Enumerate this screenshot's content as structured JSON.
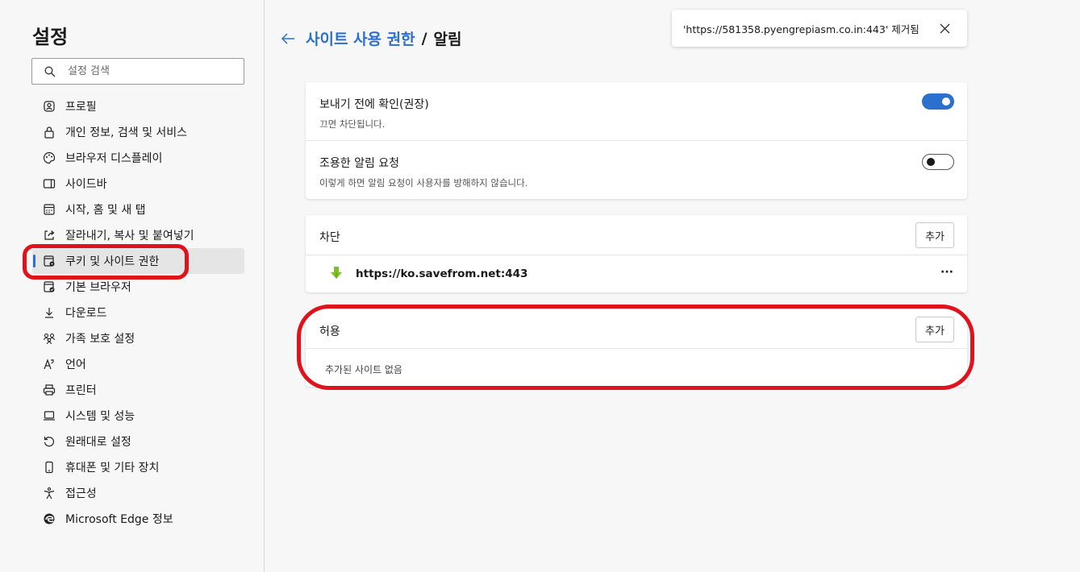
{
  "sidebar": {
    "title": "설정",
    "search_placeholder": "설정 검색",
    "items": [
      {
        "label": "프로필",
        "icon": "profile-icon"
      },
      {
        "label": "개인 정보, 검색 및 서비스",
        "icon": "lock-icon"
      },
      {
        "label": "브라우저 디스플레이",
        "icon": "palette-icon"
      },
      {
        "label": "사이드바",
        "icon": "sidebar-icon"
      },
      {
        "label": "시작, 홈 및 새 탭",
        "icon": "home-tab-icon"
      },
      {
        "label": "잘라내기, 복사 및 붙여넣기",
        "icon": "share-icon"
      },
      {
        "label": "쿠키 및 사이트 권한",
        "icon": "cookie-icon",
        "active": true
      },
      {
        "label": "기본 브라우저",
        "icon": "default-browser-icon"
      },
      {
        "label": "다운로드",
        "icon": "download-icon"
      },
      {
        "label": "가족 보호 설정",
        "icon": "family-icon"
      },
      {
        "label": "언어",
        "icon": "language-icon"
      },
      {
        "label": "프린터",
        "icon": "printer-icon"
      },
      {
        "label": "시스템 및 성능",
        "icon": "laptop-icon"
      },
      {
        "label": "원래대로 설정",
        "icon": "reset-icon"
      },
      {
        "label": "휴대폰 및 기타 장치",
        "icon": "phone-icon"
      },
      {
        "label": "접근성",
        "icon": "accessibility-icon"
      },
      {
        "label": "Microsoft Edge 정보",
        "icon": "edge-icon"
      }
    ]
  },
  "header": {
    "breadcrumb_parent": "사이트 사용 권한",
    "separator": "/",
    "current": "알림"
  },
  "toast": {
    "message": "'https://581358.pyengrepiasm.co.in:443' 제거됨"
  },
  "settings": {
    "ask_before": {
      "title": "보내기 전에 확인(권장)",
      "desc": "끄면 차단됩니다.",
      "enabled": true
    },
    "quiet": {
      "title": "조용한 알림 요청",
      "desc": "이렇게 하면 알림 요청이 사용자를 방해하지 않습니다.",
      "enabled": false
    }
  },
  "block": {
    "title": "차단",
    "add_label": "추가",
    "sites": [
      {
        "url": "https://ko.savefrom.net:443",
        "more": "···"
      }
    ]
  },
  "allow": {
    "title": "허용",
    "add_label": "추가",
    "empty": "추가된 사이트 없음"
  },
  "colors": {
    "accent": "#2b6fcf",
    "annotation": "#e0121c"
  }
}
